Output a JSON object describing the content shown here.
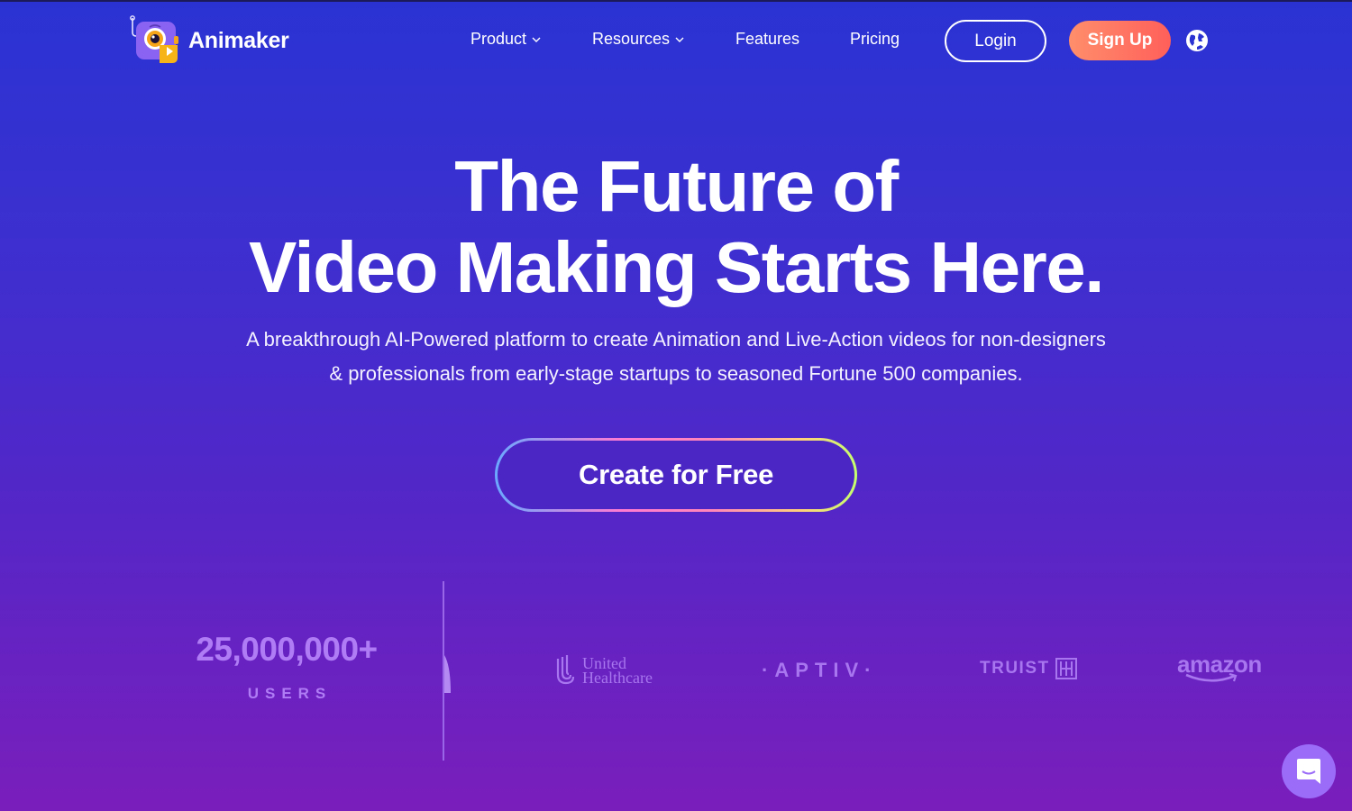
{
  "header": {
    "brand_name": "Animaker",
    "nav": [
      {
        "label": "Product",
        "has_dropdown": true
      },
      {
        "label": "Resources",
        "has_dropdown": true
      },
      {
        "label": "Features",
        "has_dropdown": false
      },
      {
        "label": "Pricing",
        "has_dropdown": false
      }
    ],
    "login_label": "Login",
    "signup_label": "Sign Up",
    "language_icon": "globe-icon"
  },
  "hero": {
    "title_line1": "The Future of",
    "title_line2": "Video Making Starts Here.",
    "subtitle_line1": "A breakthrough AI-Powered platform to create Animation and Live-Action videos for non-designers",
    "subtitle_line2": "& professionals from early-stage startups to seasoned Fortune 500 companies.",
    "cta_label": "Create for Free"
  },
  "stats": {
    "users_count": "25,000,000+",
    "users_label": "USERS"
  },
  "brands": {
    "uhc_line1": "United",
    "uhc_line2": "Healthcare",
    "aptiv": "·APTIV·",
    "truist": "TRUIST",
    "amazon": "amazon"
  },
  "chat": {
    "icon": "chat-icon"
  },
  "colors": {
    "bg_top": "#2a33d2",
    "bg_bottom": "#7a1ebb",
    "signup_start": "#ff8e6b",
    "signup_end": "#ff5f5a",
    "brand_logo_tint": "#a876ee",
    "chat_button": "#9b6cf8"
  }
}
